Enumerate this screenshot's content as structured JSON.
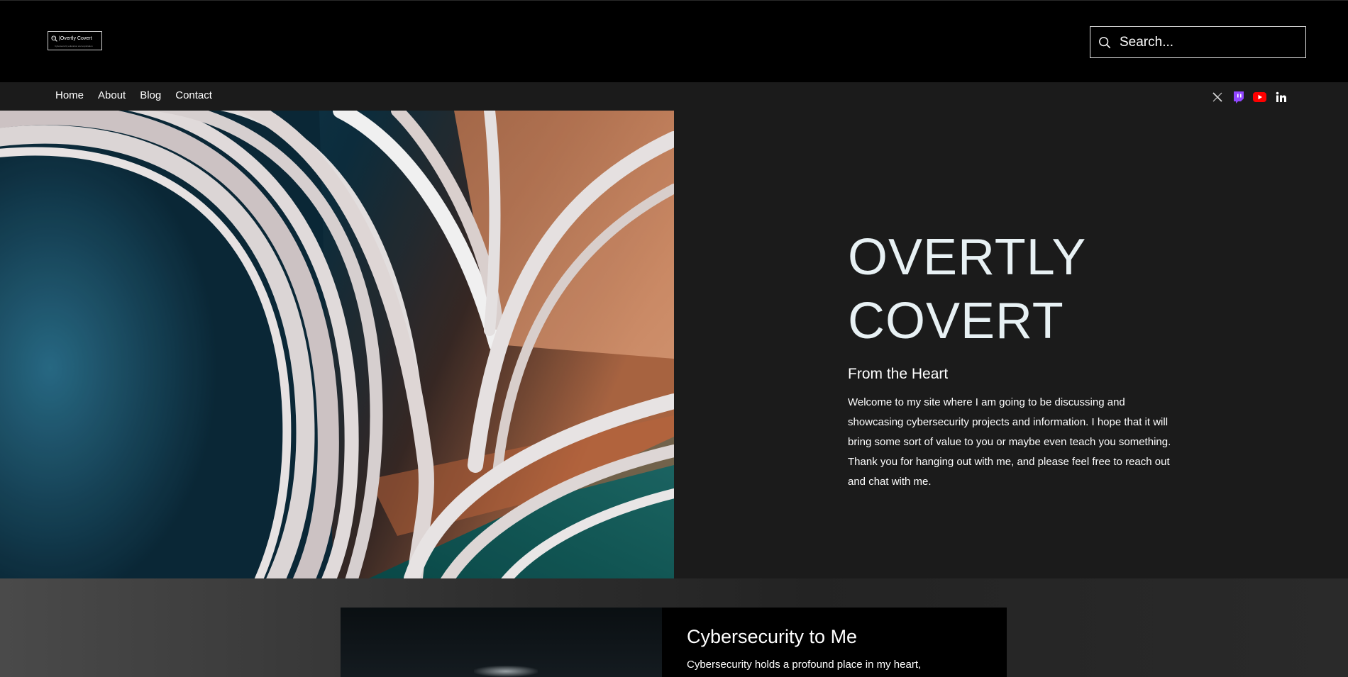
{
  "header": {
    "logo": {
      "name": "|Overtly Covert",
      "tagline": "Cybersecurity education and exploration",
      "icon": "magnifier-globe-icon"
    },
    "search": {
      "placeholder": "Search...",
      "icon": "search-icon"
    }
  },
  "nav": {
    "items": [
      {
        "label": "Home"
      },
      {
        "label": "About"
      },
      {
        "label": "Blog"
      },
      {
        "label": "Contact"
      }
    ]
  },
  "social": [
    {
      "name": "x-icon",
      "color": "#d9d9d9"
    },
    {
      "name": "twitch-icon",
      "color": "#9146ff"
    },
    {
      "name": "youtube-icon",
      "color": "#ff0000"
    },
    {
      "name": "linkedin-icon",
      "color": "#ffffff"
    }
  ],
  "hero": {
    "title": "OVERTLY COVERT",
    "subtitle": "From the Heart",
    "body": "Welcome to my site where I am going to be discussing and showcasing cybersecurity projects and information. I hope that it will bring some sort of value to you or maybe even teach you something. Thank you for hanging out with me, and please feel free to reach out and chat with me.",
    "image": "curled-magazine-pages-photo"
  },
  "feature": {
    "title": "Cybersecurity to Me",
    "body": "Cybersecurity holds a profound place in my heart,"
  },
  "colors": {
    "background": "#1b1b1b",
    "header": "#000000",
    "title": "#e8f1f4"
  }
}
